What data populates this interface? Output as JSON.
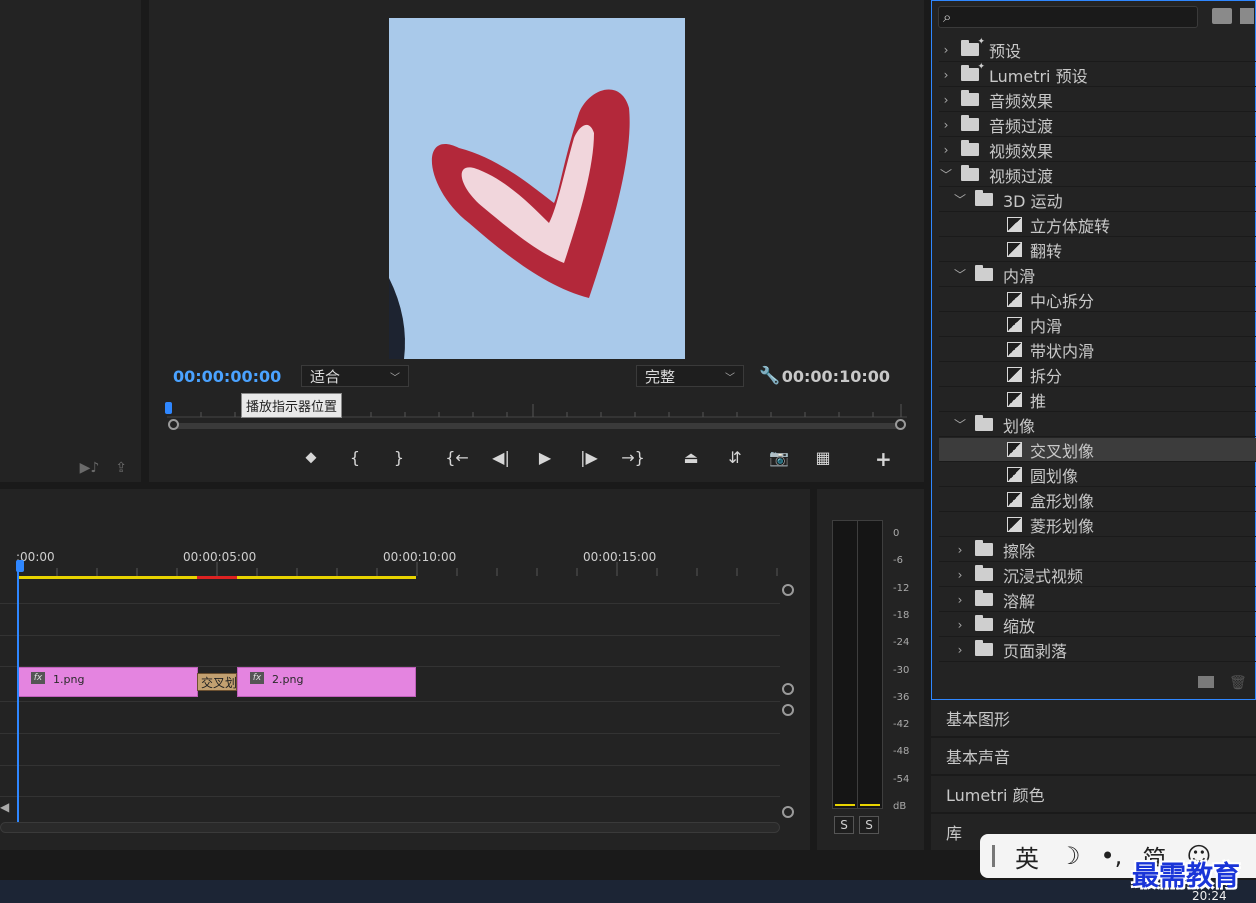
{
  "program_monitor": {
    "current_timecode": "00:00:00:00",
    "fit_option": "适合",
    "quality_option": "完整",
    "duration_timecode": "00:00:10:00",
    "tooltip": "播放指示器位置",
    "transport": [
      {
        "name": "add-marker-button",
        "glyph": "⬥"
      },
      {
        "name": "mark-in-button",
        "glyph": "{"
      },
      {
        "name": "mark-out-button",
        "glyph": "}"
      },
      {
        "name": "go-to-in-button",
        "glyph": "{←"
      },
      {
        "name": "step-back-button",
        "glyph": "◀|"
      },
      {
        "name": "play-button",
        "glyph": "▶"
      },
      {
        "name": "step-forward-button",
        "glyph": "|▶"
      },
      {
        "name": "go-to-out-button",
        "glyph": "→}"
      },
      {
        "name": "lift-button",
        "glyph": "⏏"
      },
      {
        "name": "extract-button",
        "glyph": "⇵"
      },
      {
        "name": "export-frame-button",
        "glyph": "📷"
      },
      {
        "name": "comparison-view-button",
        "glyph": "▦"
      }
    ],
    "add_glyph": "+"
  },
  "timeline": {
    "ruler_labels": [
      ":00:00",
      "00:00:05:00",
      "00:00:10:00",
      "00:00:15:00"
    ],
    "clips": [
      {
        "name": "1.png",
        "fx": "fx"
      },
      {
        "name": "2.png",
        "fx": "fx"
      }
    ],
    "transition_label": "交叉划像"
  },
  "audio_meter": {
    "db_labels": [
      "0",
      "-6",
      "-12",
      "-18",
      "-24",
      "-30",
      "-36",
      "-42",
      "-48",
      "-54",
      "dB"
    ],
    "solo_left": "S",
    "solo_right": "S"
  },
  "effects_panel": {
    "search_placeholder": "",
    "items": [
      {
        "label": "预设",
        "level": 0,
        "type": "preset-folder",
        "expanded": false
      },
      {
        "label": "Lumetri 预设",
        "level": 0,
        "type": "preset-folder",
        "expanded": false
      },
      {
        "label": "音频效果",
        "level": 0,
        "type": "folder",
        "expanded": false
      },
      {
        "label": "音频过渡",
        "level": 0,
        "type": "folder",
        "expanded": false
      },
      {
        "label": "视频效果",
        "level": 0,
        "type": "folder",
        "expanded": false
      },
      {
        "label": "视频过渡",
        "level": 0,
        "type": "folder",
        "expanded": true
      },
      {
        "label": "3D 运动",
        "level": 1,
        "type": "folder",
        "expanded": true
      },
      {
        "label": "立方体旋转",
        "level": 2,
        "type": "transition"
      },
      {
        "label": "翻转",
        "level": 2,
        "type": "transition"
      },
      {
        "label": "内滑",
        "level": 1,
        "type": "folder",
        "expanded": true
      },
      {
        "label": "中心拆分",
        "level": 2,
        "type": "transition"
      },
      {
        "label": "内滑",
        "level": 2,
        "type": "transition"
      },
      {
        "label": "带状内滑",
        "level": 2,
        "type": "transition"
      },
      {
        "label": "拆分",
        "level": 2,
        "type": "transition"
      },
      {
        "label": "推",
        "level": 2,
        "type": "transition"
      },
      {
        "label": "划像",
        "level": 1,
        "type": "folder",
        "expanded": true
      },
      {
        "label": "交叉划像",
        "level": 2,
        "type": "transition",
        "selected": true
      },
      {
        "label": "圆划像",
        "level": 2,
        "type": "transition"
      },
      {
        "label": "盒形划像",
        "level": 2,
        "type": "transition"
      },
      {
        "label": "菱形划像",
        "level": 2,
        "type": "transition"
      },
      {
        "label": "擦除",
        "level": 1,
        "type": "folder",
        "expanded": false
      },
      {
        "label": "沉浸式视频",
        "level": 1,
        "type": "folder",
        "expanded": false
      },
      {
        "label": "溶解",
        "level": 1,
        "type": "folder",
        "expanded": false
      },
      {
        "label": "缩放",
        "level": 1,
        "type": "folder",
        "expanded": false
      },
      {
        "label": "页面剥落",
        "level": 1,
        "type": "folder",
        "expanded": false
      }
    ]
  },
  "side_tabs": [
    "基本图形",
    "基本声音",
    "Lumetri 颜色",
    "库"
  ],
  "ime": {
    "language": "英",
    "mode": "简",
    "moon_glyph": "☽",
    "punct_glyph": "•,",
    "emoji_glyph": "☺"
  },
  "watermark": "最需教育",
  "taskbar": {
    "clock": "20:24"
  },
  "colors": {
    "accent": "#2f87ff",
    "clip": "#e484e0",
    "work_area": "#e8d300"
  }
}
